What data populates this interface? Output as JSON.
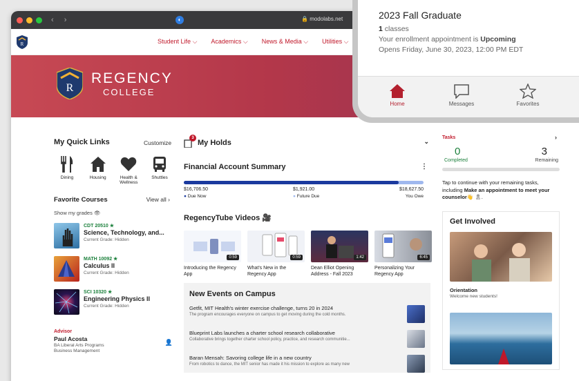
{
  "browser": {
    "url": "modolabs.net"
  },
  "nav": {
    "items": [
      "Student Life",
      "Academics",
      "News & Media",
      "Utilities"
    ]
  },
  "banner": {
    "name": "REGENCY",
    "sub": "COLLEGE",
    "crest_letter": "R"
  },
  "quick_links": {
    "title": "My Quick Links",
    "customize": "Customize",
    "items": [
      {
        "label": "Dining",
        "icon": "fork-knife-icon"
      },
      {
        "label": "Housing",
        "icon": "house-icon"
      },
      {
        "label": "Health & Wellness",
        "icon": "heart-icon"
      },
      {
        "label": "Shuttles",
        "icon": "bus-icon"
      }
    ]
  },
  "favorites": {
    "title": "Favorite Courses",
    "view_all": "View all",
    "show_grades": "Show my grades",
    "courses": [
      {
        "code": "CDT 20510 ★",
        "title": "Science, Technology, and...",
        "grade": "Current Grade: Hidden"
      },
      {
        "code": "MATH 10092 ★",
        "title": "Calculus II",
        "grade": "Current Grade: Hidden"
      },
      {
        "code": "SCI 10320 ★",
        "title": "Engineering Physics II",
        "grade": "Current Grade: Hidden"
      }
    ]
  },
  "advisor": {
    "heading": "Advisor",
    "name": "Paul Acosta",
    "program": "BA Liberal Arts Programs",
    "dept": "Business Management"
  },
  "holds": {
    "title": "My Holds",
    "count": "3"
  },
  "finance": {
    "title": "Financial Account Summary",
    "due_now": "$16,706.50",
    "due_now_label": "Due Now",
    "future": "$1,921.00",
    "future_label": "Future Due",
    "owe": "$18,627.50",
    "owe_label": "You Owe",
    "due_fraction": 0.897
  },
  "tube": {
    "title": "RegencyTube Videos 🎥",
    "videos": [
      {
        "title": "Introducing the Regency App",
        "duration": "0:59"
      },
      {
        "title": "What's New in the Regency App",
        "duration": "0:59"
      },
      {
        "title": "Dean Elliot Opening Address - Fall 2023",
        "duration": "1:42"
      },
      {
        "title": "Personalizing Your Regency App",
        "duration": "6:45"
      }
    ]
  },
  "events": {
    "title": "New Events on Campus",
    "items": [
      {
        "title": "Getfit, MIT Health's winter exercise challenge, turns 20 in 2024",
        "summary": "The program encourages everyone on campus to get moving during the cold months."
      },
      {
        "title": "Blueprint Labs launches a charter school research collaborative",
        "summary": "Collaborative brings together charter school policy, practice, and research communitie..."
      },
      {
        "title": "Baran Mensah: Savoring college life in a new country",
        "summary": "From robotics to dance, the MIT senior has made it his mission to explore as many new"
      }
    ]
  },
  "tasks": {
    "title": "Tasks",
    "completed": "0",
    "completed_label": "Completed",
    "remaining": "3",
    "remaining_label": "Remaining",
    "desc": "Tap to continue with your remaining tasks, including",
    "desc_bold": "Make an appointment to meet your counselor",
    "desc_end": "👋 🎗."
  },
  "get_involved": {
    "title": "Get Involved",
    "card_title": "Orientation",
    "card_sub": "Welcome new students!"
  },
  "phone": {
    "title": "2023 Fall Graduate",
    "classes_num": "1",
    "classes_label": "classes",
    "enroll_prefix": "Your enrollment appointment is",
    "enroll_status": "Upcoming",
    "opens": "Opens Friday, June 30, 2023, 12:00 PM EDT",
    "tabs": [
      "Home",
      "Messages",
      "Favorites"
    ]
  }
}
